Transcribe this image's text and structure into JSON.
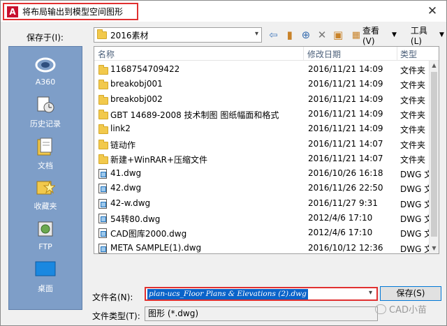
{
  "window": {
    "title": "将布局输出到模型空间图形",
    "app_icon_letter": "A",
    "close_glyph": "✕"
  },
  "save_in": {
    "label": "保存于(I):",
    "folder": "2016素材"
  },
  "toolbar": {
    "view_label": "查看(V)",
    "tools_label": "工具(L)"
  },
  "places": [
    {
      "label": "A360",
      "icon": "cloud-icon"
    },
    {
      "label": "历史记录",
      "icon": "history-icon"
    },
    {
      "label": "文档",
      "icon": "documents-icon"
    },
    {
      "label": "收藏夹",
      "icon": "favorites-icon"
    },
    {
      "label": "FTP",
      "icon": "ftp-icon"
    },
    {
      "label": "桌面",
      "icon": "desktop-icon"
    }
  ],
  "file_list": {
    "columns": [
      "名称",
      "修改日期",
      "类型"
    ],
    "rows": [
      {
        "name": "1168754709422",
        "date": "2016/11/21 14:09",
        "type": "文件夹",
        "kind": "folder"
      },
      {
        "name": "breakobj001",
        "date": "2016/11/21 14:09",
        "type": "文件夹",
        "kind": "folder"
      },
      {
        "name": "breakobj002",
        "date": "2016/11/21 14:09",
        "type": "文件夹",
        "kind": "folder"
      },
      {
        "name": "GBT 14689-2008 技术制图 图纸幅面和格式",
        "date": "2016/11/21 14:09",
        "type": "文件夹",
        "kind": "folder"
      },
      {
        "name": "link2",
        "date": "2016/11/21 14:09",
        "type": "文件夹",
        "kind": "folder"
      },
      {
        "name": "链动作",
        "date": "2016/11/21 14:07",
        "type": "文件夹",
        "kind": "folder"
      },
      {
        "name": "新建+WinRAR+压缩文件",
        "date": "2016/11/21 14:07",
        "type": "文件夹",
        "kind": "folder"
      },
      {
        "name": "41.dwg",
        "date": "2016/10/26 16:18",
        "type": "DWG 文",
        "kind": "dwg"
      },
      {
        "name": "42.dwg",
        "date": "2016/11/26 22:50",
        "type": "DWG 文",
        "kind": "dwg"
      },
      {
        "name": "42-w.dwg",
        "date": "2016/11/27 9:31",
        "type": "DWG 文",
        "kind": "dwg"
      },
      {
        "name": "54转80.dwg",
        "date": "2012/4/6 17:10",
        "type": "DWG 文",
        "kind": "dwg"
      },
      {
        "name": "CAD图库2000.dwg",
        "date": "2012/4/6 17:10",
        "type": "DWG 文",
        "kind": "dwg"
      },
      {
        "name": "META SAMPLE(1).dwg",
        "date": "2016/10/12 12:36",
        "type": "DWG 文",
        "kind": "dwg"
      }
    ]
  },
  "file_name": {
    "label": "文件名(N):",
    "value": "plan-ucs_Floor Plans & Elevations (2).dwg"
  },
  "file_type": {
    "label": "文件类型(T):",
    "value": "图形 (*.dwg)"
  },
  "buttons": {
    "save": "保存(S)"
  },
  "watermark": "CAD小苗"
}
